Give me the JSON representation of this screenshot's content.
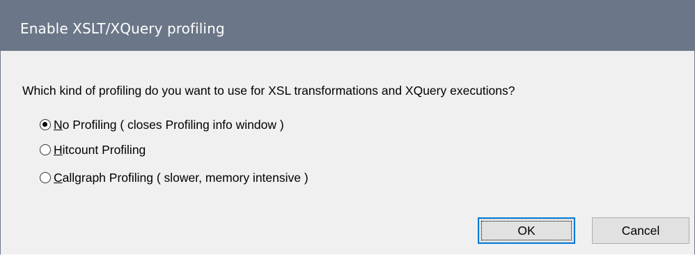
{
  "dialog": {
    "title": "Enable XSLT/XQuery profiling",
    "question": "Which kind of profiling do you want to use for XSL transformations and XQuery executions?",
    "options": [
      {
        "accel": "N",
        "rest": "o Profiling ( closes Profiling info window )",
        "checked": true
      },
      {
        "accel": "H",
        "rest": "itcount Profiling",
        "checked": false
      },
      {
        "accel": "C",
        "rest": "allgraph Profiling ( slower, memory intensive )",
        "checked": false
      }
    ],
    "ok_label": "OK",
    "cancel_label": "Cancel"
  },
  "colors": {
    "titlebar": "#6b7788",
    "dialog_bg": "#f0f0f0",
    "button_bg": "#e1e1e1",
    "focus_border": "#0078d7"
  }
}
